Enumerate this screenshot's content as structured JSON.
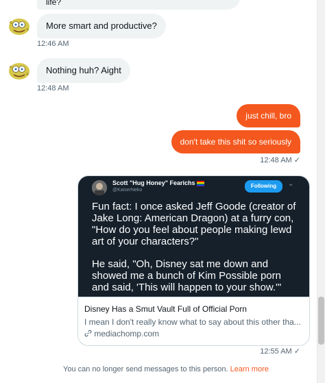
{
  "messages": {
    "partial_top": "life?",
    "in1": "More smart and productive?",
    "in1_time": "12:46 AM",
    "in2": "Nothing huh? Aight",
    "in2_time": "12:48 AM",
    "out1": "just chill, bro",
    "out2": "don't take this shit so seriously",
    "out_time": "12:48 AM",
    "card_time": "12:55 AM"
  },
  "tweet": {
    "name": "Scott \"Hug Honey\" Fearichs",
    "handle": "@KaiserNeko",
    "follow_label": "Following",
    "paragraph1": "Fun fact: I once asked Jeff Goode (creator of Jake Long: American Dragon) at a furry con, \"How do you feel about people making lewd art of your characters?\"",
    "paragraph2": "He said, \"Oh, Disney sat me down and showed me a bunch of Kim Possible porn and said, 'This will happen to your show.'\""
  },
  "link": {
    "title": "Disney Has a Smut Vault Full of Official Porn",
    "description": "I mean I don't really know what to say about this other tha...",
    "domain": "mediachomp.com"
  },
  "footer": {
    "text": "You can no longer send messages to this person.",
    "learn_more": "Learn more"
  },
  "icons": {
    "avatar": "cartoon-avatar-icon",
    "read_check": "check-icon",
    "link": "link-icon",
    "caret": "chevron-down-icon"
  },
  "colors": {
    "outgoing_bubble": "#f4581e",
    "incoming_bubble": "#eff3f4",
    "follow_button": "#1d9bf0",
    "tweet_bg": "#15202b"
  }
}
